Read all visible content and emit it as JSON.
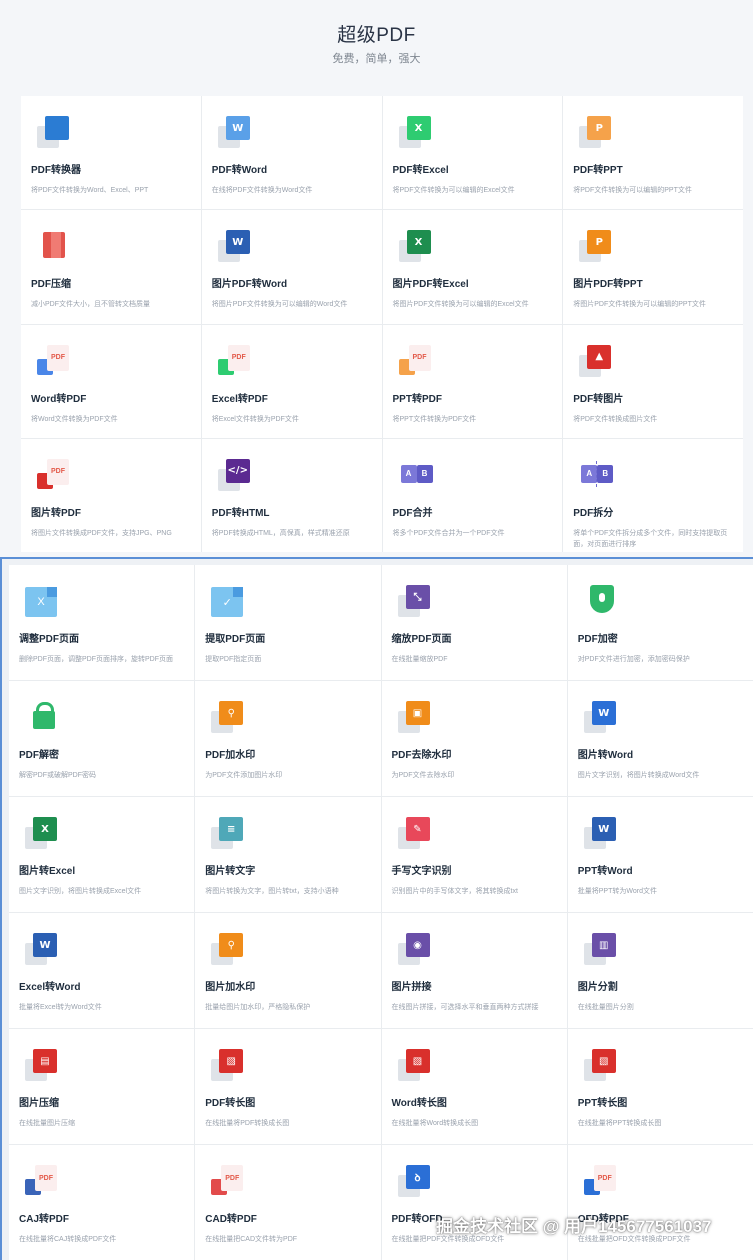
{
  "header": {
    "title": "超级PDF",
    "subtitle": "免费，简单，强大"
  },
  "tools1": [
    {
      "name": "PDF转换器",
      "desc": "将PDF文件转换为Word、Excel、PPT",
      "icon": "office-icon",
      "glyph": "",
      "color": "#2b7cd3"
    },
    {
      "name": "PDF转Word",
      "desc": "在线将PDF文件转换为Word文件",
      "icon": "word-icon",
      "glyph": "W",
      "color": "#5aa0e8"
    },
    {
      "name": "PDF转Excel",
      "desc": "将PDF文件转换为可以编辑的Excel文件",
      "icon": "excel-icon",
      "glyph": "X",
      "color": "#2ecc71"
    },
    {
      "name": "PDF转PPT",
      "desc": "将PDF文件转换为可以编辑的PPT文件",
      "icon": "ppt-icon",
      "glyph": "P",
      "color": "#f5a24a"
    },
    {
      "name": "PDF压缩",
      "desc": "减小PDF文件大小，且不管转文档质量",
      "icon": "compress-book-icon",
      "glyph": "",
      "color": "#e2534b"
    },
    {
      "name": "图片PDF转Word",
      "desc": "将图片PDF文件转换为可以编辑的Word文件",
      "icon": "word-icon",
      "glyph": "W",
      "color": "#2b5fb3"
    },
    {
      "name": "图片PDF转Excel",
      "desc": "将图片PDF文件转换为可以编辑的Excel文件",
      "icon": "excel-icon",
      "glyph": "X",
      "color": "#1e8e4f"
    },
    {
      "name": "图片PDF转PPT",
      "desc": "将图片PDF文件转换为可以编辑的PPT文件",
      "icon": "ppt-icon",
      "glyph": "P",
      "color": "#f08c1a"
    },
    {
      "name": "Word转PDF",
      "desc": "将Word文件转换为PDF文件",
      "icon": "word-to-pdf-icon",
      "glyph": "PDF",
      "color": "#4a86e8"
    },
    {
      "name": "Excel转PDF",
      "desc": "将Excel文件转换为PDF文件",
      "icon": "excel-to-pdf-icon",
      "glyph": "PDF",
      "color": "#2ecc71"
    },
    {
      "name": "PPT转PDF",
      "desc": "将PPT文件转换为PDF文件",
      "icon": "ppt-to-pdf-icon",
      "glyph": "PDF",
      "color": "#f5a24a"
    },
    {
      "name": "PDF转图片",
      "desc": "将PDF文件转换成图片文件",
      "icon": "image-icon",
      "glyph": "▲",
      "color": "#d9302c"
    },
    {
      "name": "图片转PDF",
      "desc": "将图片文件转换成PDF文件，支持JPG、PNG",
      "icon": "image-to-pdf-icon",
      "glyph": "PDF",
      "color": "#d9302c"
    },
    {
      "name": "PDF转HTML",
      "desc": "将PDF转换成HTML，高保真，样式精准还原",
      "icon": "code-icon",
      "glyph": "</>",
      "color": "#5b2a91"
    },
    {
      "name": "PDF合并",
      "desc": "将多个PDF文件合并为一个PDF文件",
      "icon": "merge-icon",
      "glyph": "A B",
      "color": "#6e6bd0"
    },
    {
      "name": "PDF拆分",
      "desc": "将单个PDF文件拆分成多个文件，同时支持提取页面，对页面进行排序",
      "icon": "split-icon",
      "glyph": "A B",
      "color": "#6e6bd0"
    }
  ],
  "tools2": [
    {
      "name": "调整PDF页面",
      "desc": "删除PDF页面，调整PDF页面排序，旋转PDF页面",
      "icon": "folder-x-icon",
      "glyph": "X",
      "color": "#7cc4f0"
    },
    {
      "name": "提取PDF页面",
      "desc": "提取PDF指定页面",
      "icon": "folder-check-icon",
      "glyph": "✓",
      "color": "#7cc4f0"
    },
    {
      "name": "缩放PDF页面",
      "desc": "在线批量缩放PDF",
      "icon": "scale-icon",
      "glyph": "⤡",
      "color": "#6a4fa8"
    },
    {
      "name": "PDF加密",
      "desc": "对PDF文件进行加密，添加密码保护",
      "icon": "shield-icon",
      "glyph": "",
      "color": "#2fb86b"
    },
    {
      "name": "PDF解密",
      "desc": "解密PDF或破解PDF密码",
      "icon": "unlock-icon",
      "glyph": "",
      "color": "#2fb86b"
    },
    {
      "name": "PDF加水印",
      "desc": "为PDF文件添加图片水印",
      "icon": "stamp-icon",
      "glyph": "⚲",
      "color": "#f08c1a"
    },
    {
      "name": "PDF去除水印",
      "desc": "为PDF文件去除水印",
      "icon": "stamp-remove-icon",
      "glyph": "▣",
      "color": "#f08c1a"
    },
    {
      "name": "图片转Word",
      "desc": "图片文字识别，将图片转换成Word文件",
      "icon": "word-icon",
      "glyph": "W",
      "color": "#2b6fd6"
    },
    {
      "name": "图片转Excel",
      "desc": "图片文字识别，将图片转换成Excel文件",
      "icon": "excel-icon",
      "glyph": "X",
      "color": "#1e8e4f"
    },
    {
      "name": "图片转文字",
      "desc": "将图片转换为文字，图片转txt，支持小语种",
      "icon": "text-doc-icon",
      "glyph": "≡",
      "color": "#4fa8b8"
    },
    {
      "name": "手写文字识别",
      "desc": "识别图片中的手写体文字，将其转换成txt",
      "icon": "pen-icon",
      "glyph": "✎",
      "color": "#e8485a"
    },
    {
      "name": "PPT转Word",
      "desc": "批量将PPT转为Word文件",
      "icon": "word-icon",
      "glyph": "W",
      "color": "#2b5fb3"
    },
    {
      "name": "Excel转Word",
      "desc": "批量将Excel转为Word文件",
      "icon": "word-icon",
      "glyph": "W",
      "color": "#2b5fb3"
    },
    {
      "name": "图片加水印",
      "desc": "批量给图片加水印，严格隐私保护",
      "icon": "stamp-icon",
      "glyph": "⚲",
      "color": "#f08c1a"
    },
    {
      "name": "图片拼接",
      "desc": "在线图片拼接，可选择水平和垂直两种方式拼接",
      "icon": "eye-icon",
      "glyph": "◉",
      "color": "#6a4fa8"
    },
    {
      "name": "图片分割",
      "desc": "在线批量图片分割",
      "icon": "split-image-icon",
      "glyph": "▥",
      "color": "#6a4fa8"
    },
    {
      "name": "图片压缩",
      "desc": "在线批量图片压缩",
      "icon": "compress-icon",
      "glyph": "▤",
      "color": "#d9302c"
    },
    {
      "name": "PDF转长图",
      "desc": "在线批量将PDF转换成长图",
      "icon": "long-image-icon",
      "glyph": "▧",
      "color": "#d9302c"
    },
    {
      "name": "Word转长图",
      "desc": "在线批量将Word转换成长图",
      "icon": "long-image-icon",
      "glyph": "▧",
      "color": "#d9302c"
    },
    {
      "name": "PPT转长图",
      "desc": "在线批量将PPT转换成长图",
      "icon": "long-image-icon",
      "glyph": "▧",
      "color": "#d9302c"
    },
    {
      "name": "CAJ转PDF",
      "desc": "在线批量将CAJ转换成PDF文件",
      "icon": "caj-to-pdf-icon",
      "glyph": "PDF",
      "color": "#3a64b8"
    },
    {
      "name": "CAD转PDF",
      "desc": "在线批量把CAD文件转为PDF",
      "icon": "cad-to-pdf-icon",
      "glyph": "PDF",
      "color": "#e24b4b"
    },
    {
      "name": "PDF转OFD",
      "desc": "在线批量把PDF文件转换成OFD文件",
      "icon": "ofd-icon",
      "glyph": "ꝺ",
      "color": "#2b6fd6"
    },
    {
      "name": "OFD转PDF",
      "desc": "在线批量把OFD文件转换成PDF文件",
      "icon": "ofd-to-pdf-icon",
      "glyph": "PDF",
      "color": "#2b6fd6"
    }
  ],
  "watermark": "掘金技术社区 @ 用户145677561037"
}
